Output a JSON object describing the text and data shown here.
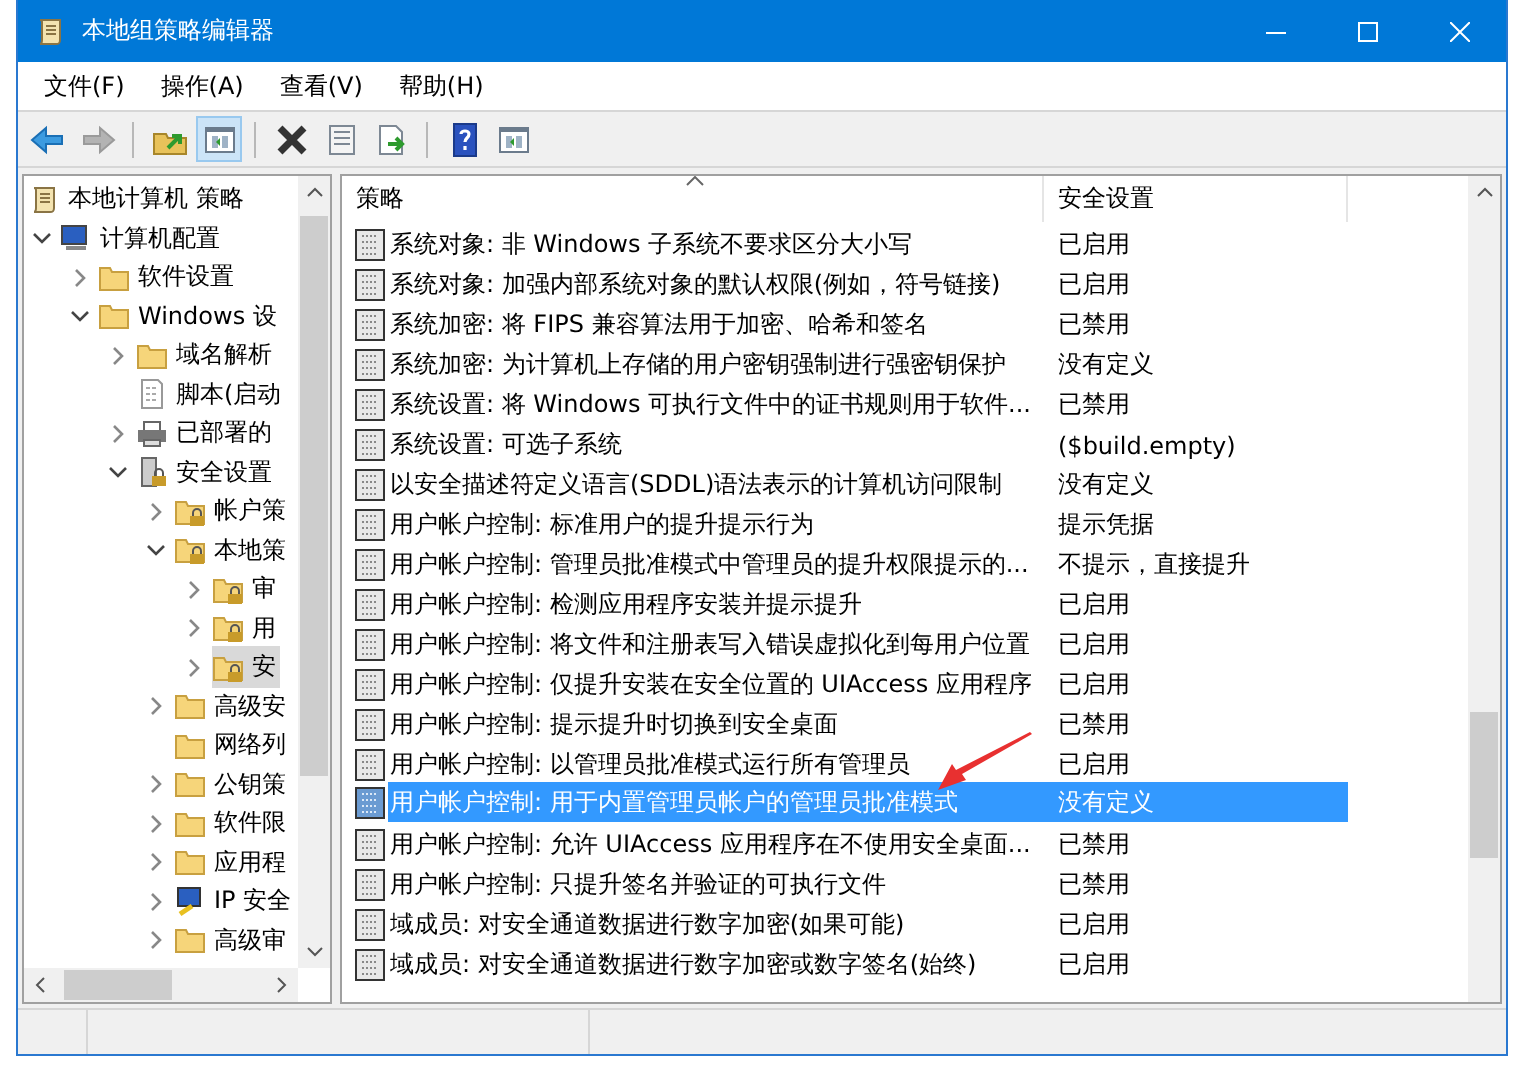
{
  "window": {
    "title": "本地组策略编辑器"
  },
  "menu": [
    "文件(F)",
    "操作(A)",
    "查看(V)",
    "帮助(H)"
  ],
  "toolbar": [
    [
      {
        "kind": "back",
        "disabled": false,
        "pressed": false
      },
      {
        "kind": "forward",
        "disabled": true,
        "pressed": false
      }
    ],
    [
      {
        "kind": "up",
        "disabled": false,
        "pressed": false
      },
      {
        "kind": "tree",
        "disabled": false,
        "pressed": true
      }
    ],
    [
      {
        "kind": "delete",
        "disabled": false,
        "pressed": false
      },
      {
        "kind": "properties",
        "disabled": false,
        "pressed": false
      },
      {
        "kind": "export",
        "disabled": false,
        "pressed": false
      }
    ],
    [
      {
        "kind": "help",
        "disabled": false,
        "pressed": false
      },
      {
        "kind": "pane",
        "disabled": false,
        "pressed": false
      }
    ]
  ],
  "tree": [
    {
      "label": "本地计算机 策略",
      "kind": "policy",
      "selected": false,
      "children": [
        {
          "label": "计算机配置",
          "kind": "computer",
          "has_children": true,
          "expanded": true,
          "selected": false,
          "children": [
            {
              "label": "软件设置",
              "kind": "folder",
              "has_children": true,
              "expanded": false,
              "selected": false
            },
            {
              "label": "Windows 设",
              "kind": "folder",
              "has_children": true,
              "expanded": true,
              "selected": false,
              "children": [
                {
                  "label": "域名解析",
                  "kind": "folder",
                  "has_children": true,
                  "expanded": false,
                  "selected": false
                },
                {
                  "label": "脚本(启动",
                  "kind": "script",
                  "has_children": false,
                  "selected": false
                },
                {
                  "label": "已部署的",
                  "kind": "printer",
                  "has_children": true,
                  "expanded": false,
                  "selected": false
                },
                {
                  "label": "安全设置",
                  "kind": "security",
                  "has_children": true,
                  "expanded": true,
                  "selected": false,
                  "children": [
                    {
                      "label": "帐户策",
                      "kind": "lockfolder",
                      "has_children": true,
                      "expanded": false,
                      "selected": false
                    },
                    {
                      "label": "本地策",
                      "kind": "lockfolder",
                      "has_children": true,
                      "expanded": true,
                      "selected": false,
                      "children": [
                        {
                          "label": "审",
                          "kind": "lockfolder",
                          "has_children": true,
                          "expanded": false,
                          "selected": false
                        },
                        {
                          "label": "用",
                          "kind": "lockfolder",
                          "has_children": true,
                          "expanded": false,
                          "selected": false
                        },
                        {
                          "label": "安",
                          "kind": "lockfolder",
                          "has_children": true,
                          "expanded": false,
                          "selected": true
                        }
                      ]
                    },
                    {
                      "label": "高级安",
                      "kind": "folder",
                      "has_children": true,
                      "expanded": false,
                      "selected": false
                    },
                    {
                      "label": "网络列",
                      "kind": "folder",
                      "has_children": false,
                      "selected": false
                    },
                    {
                      "label": "公钥策",
                      "kind": "folder",
                      "has_children": true,
                      "expanded": false,
                      "selected": false
                    },
                    {
                      "label": "软件限",
                      "kind": "folder",
                      "has_children": true,
                      "expanded": false,
                      "selected": false
                    },
                    {
                      "label": "应用程",
                      "kind": "folder",
                      "has_children": true,
                      "expanded": false,
                      "selected": false
                    },
                    {
                      "label": "IP 安全",
                      "kind": "ipsec",
                      "has_children": true,
                      "expanded": false,
                      "selected": false
                    },
                    {
                      "label": "高级审",
                      "kind": "folder",
                      "has_children": true,
                      "expanded": false,
                      "selected": false
                    }
                  ]
                }
              ]
            }
          ]
        }
      ]
    }
  ],
  "table": {
    "columns": [
      {
        "label": "策略",
        "sorted": true
      },
      {
        "label": "安全设置",
        "sorted": false
      }
    ],
    "rows": [
      {
        "policy": "系统对象: 非 Windows 子系统不要求区分大小写",
        "setting": "已启用",
        "selected": false
      },
      {
        "policy": "系统对象: 加强内部系统对象的默认权限(例如，符号链接)",
        "setting": "已启用",
        "selected": false
      },
      {
        "policy": "系统加密: 将 FIPS 兼容算法用于加密、哈希和签名",
        "setting": "已禁用",
        "selected": false
      },
      {
        "policy": "系统加密: 为计算机上存储的用户密钥强制进行强密钥保护",
        "setting": "没有定义",
        "selected": false
      },
      {
        "policy": "系统设置: 将 Windows 可执行文件中的证书规则用于软件...",
        "setting": "已禁用",
        "selected": false
      },
      {
        "policy": "系统设置: 可选子系统",
        "setting": "($build.empty)",
        "selected": false
      },
      {
        "policy": "以安全描述符定义语言(SDDL)语法表示的计算机访问限制",
        "setting": "没有定义",
        "selected": false
      },
      {
        "policy": "用户帐户控制: 标准用户的提升提示行为",
        "setting": "提示凭据",
        "selected": false
      },
      {
        "policy": "用户帐户控制: 管理员批准模式中管理员的提升权限提示的...",
        "setting": "不提示，直接提升",
        "selected": false
      },
      {
        "policy": "用户帐户控制: 检测应用程序安装并提示提升",
        "setting": "已启用",
        "selected": false
      },
      {
        "policy": "用户帐户控制: 将文件和注册表写入错误虚拟化到每用户位置",
        "setting": "已启用",
        "selected": false
      },
      {
        "policy": "用户帐户控制: 仅提升安装在安全位置的 UIAccess 应用程序",
        "setting": "已启用",
        "selected": false
      },
      {
        "policy": "用户帐户控制: 提示提升时切换到安全桌面",
        "setting": "已禁用",
        "selected": false
      },
      {
        "policy": "用户帐户控制: 以管理员批准模式运行所有管理员",
        "setting": "已启用",
        "selected": false
      },
      {
        "policy": "用户帐户控制: 用于内置管理员帐户的管理员批准模式",
        "setting": "没有定义",
        "selected": true
      },
      {
        "policy": "用户帐户控制: 允许 UIAccess 应用程序在不使用安全桌面...",
        "setting": "已禁用",
        "selected": false
      },
      {
        "policy": "用户帐户控制: 只提升签名并验证的可执行文件",
        "setting": "已禁用",
        "selected": false
      },
      {
        "policy": "域成员: 对安全通道数据进行数字加密(如果可能)",
        "setting": "已启用",
        "selected": false
      },
      {
        "policy": "域成员: 对安全通道数据进行数字加密或数字签名(始终)",
        "setting": "已启用",
        "selected": false
      }
    ]
  }
}
